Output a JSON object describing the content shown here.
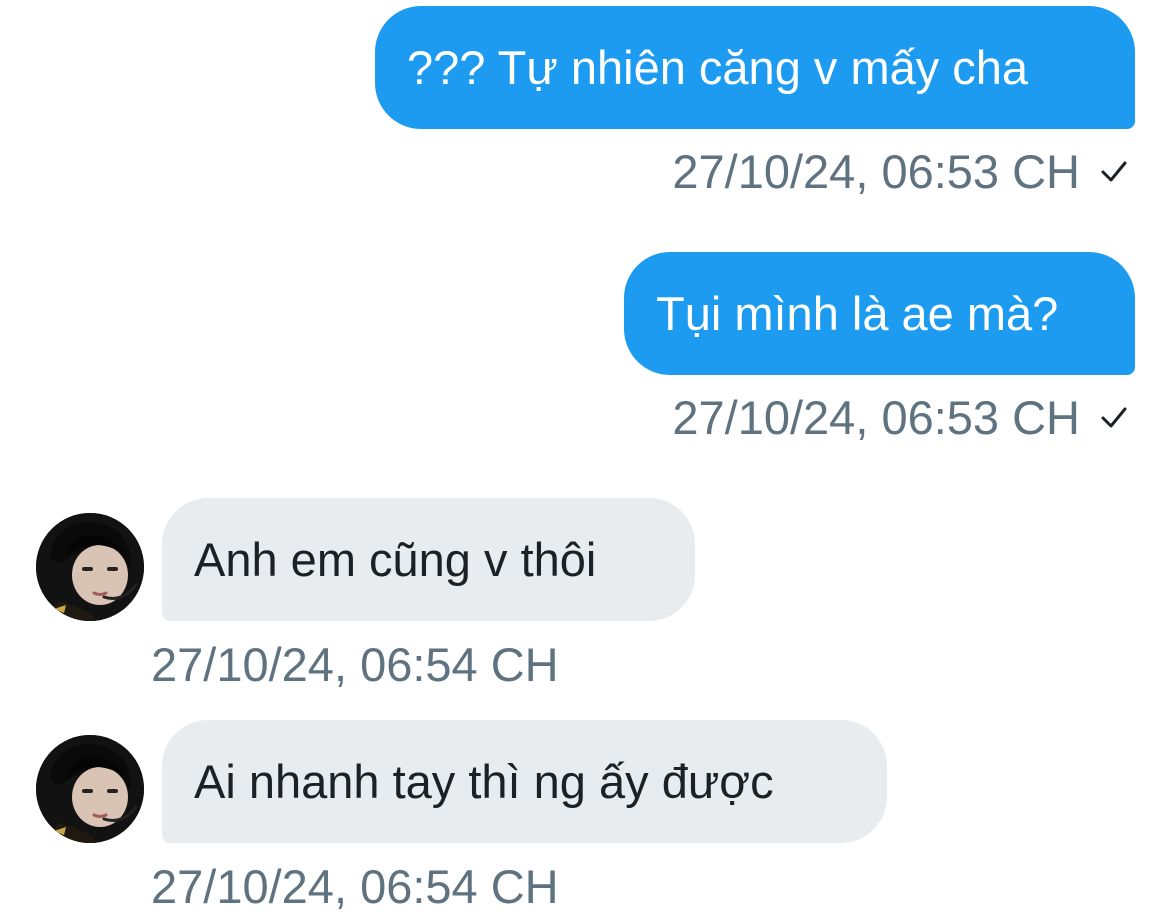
{
  "conversation": {
    "messages": [
      {
        "direction": "sent",
        "text": "??? Tự nhiên căng v mấy cha",
        "timestamp": "27/10/24, 06:53 CH",
        "status_icon": "check-icon"
      },
      {
        "direction": "sent",
        "text": "Tụi mình là ae mà?",
        "timestamp": "27/10/24, 06:53 CH",
        "status_icon": "check-icon"
      },
      {
        "direction": "received",
        "text": "Anh em cũng v thôi",
        "timestamp": "27/10/24, 06:54 CH",
        "avatar_icon": "user-avatar"
      },
      {
        "direction": "received",
        "text": "Ai nhanh tay thì ng ấy được",
        "timestamp": "27/10/24, 06:54 CH",
        "avatar_icon": "user-avatar"
      }
    ]
  },
  "colors": {
    "sent_bubble": "#1d9bf0",
    "received_bubble": "#e8ecef",
    "timestamp": "#5f7280",
    "received_text": "#1c2126"
  }
}
